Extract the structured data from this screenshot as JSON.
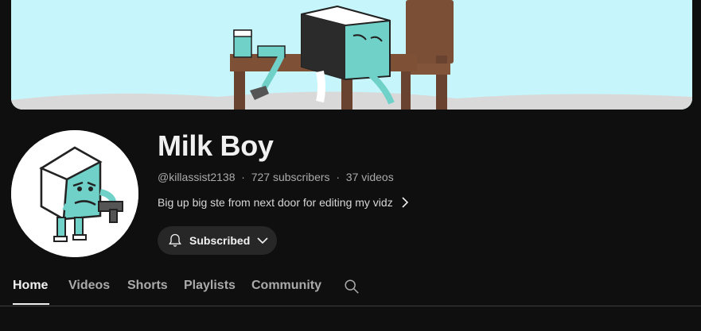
{
  "channel": {
    "name": "Milk Boy",
    "handle": "@killassist2138",
    "subscribers": "727 subscribers",
    "videos": "37 videos",
    "separator": "·",
    "description": "Big up big ste from next door for editing my vidz"
  },
  "subscribe_button": {
    "label": "Subscribed",
    "icon": "bell-icon",
    "dropdown_icon": "chevron-down-icon"
  },
  "tabs": [
    {
      "label": "Home",
      "active": true
    },
    {
      "label": "Videos",
      "active": false
    },
    {
      "label": "Shorts",
      "active": false
    },
    {
      "label": "Playlists",
      "active": false
    },
    {
      "label": "Community",
      "active": false
    }
  ],
  "tab_search_icon": "search-icon",
  "colors": {
    "background": "#0f0f0f",
    "banner_sky": "#c6f6fb",
    "carton": "#6fd1c8",
    "button_bg": "#272727",
    "text_primary": "#f1f1f1",
    "text_secondary": "#aaaaaa"
  }
}
